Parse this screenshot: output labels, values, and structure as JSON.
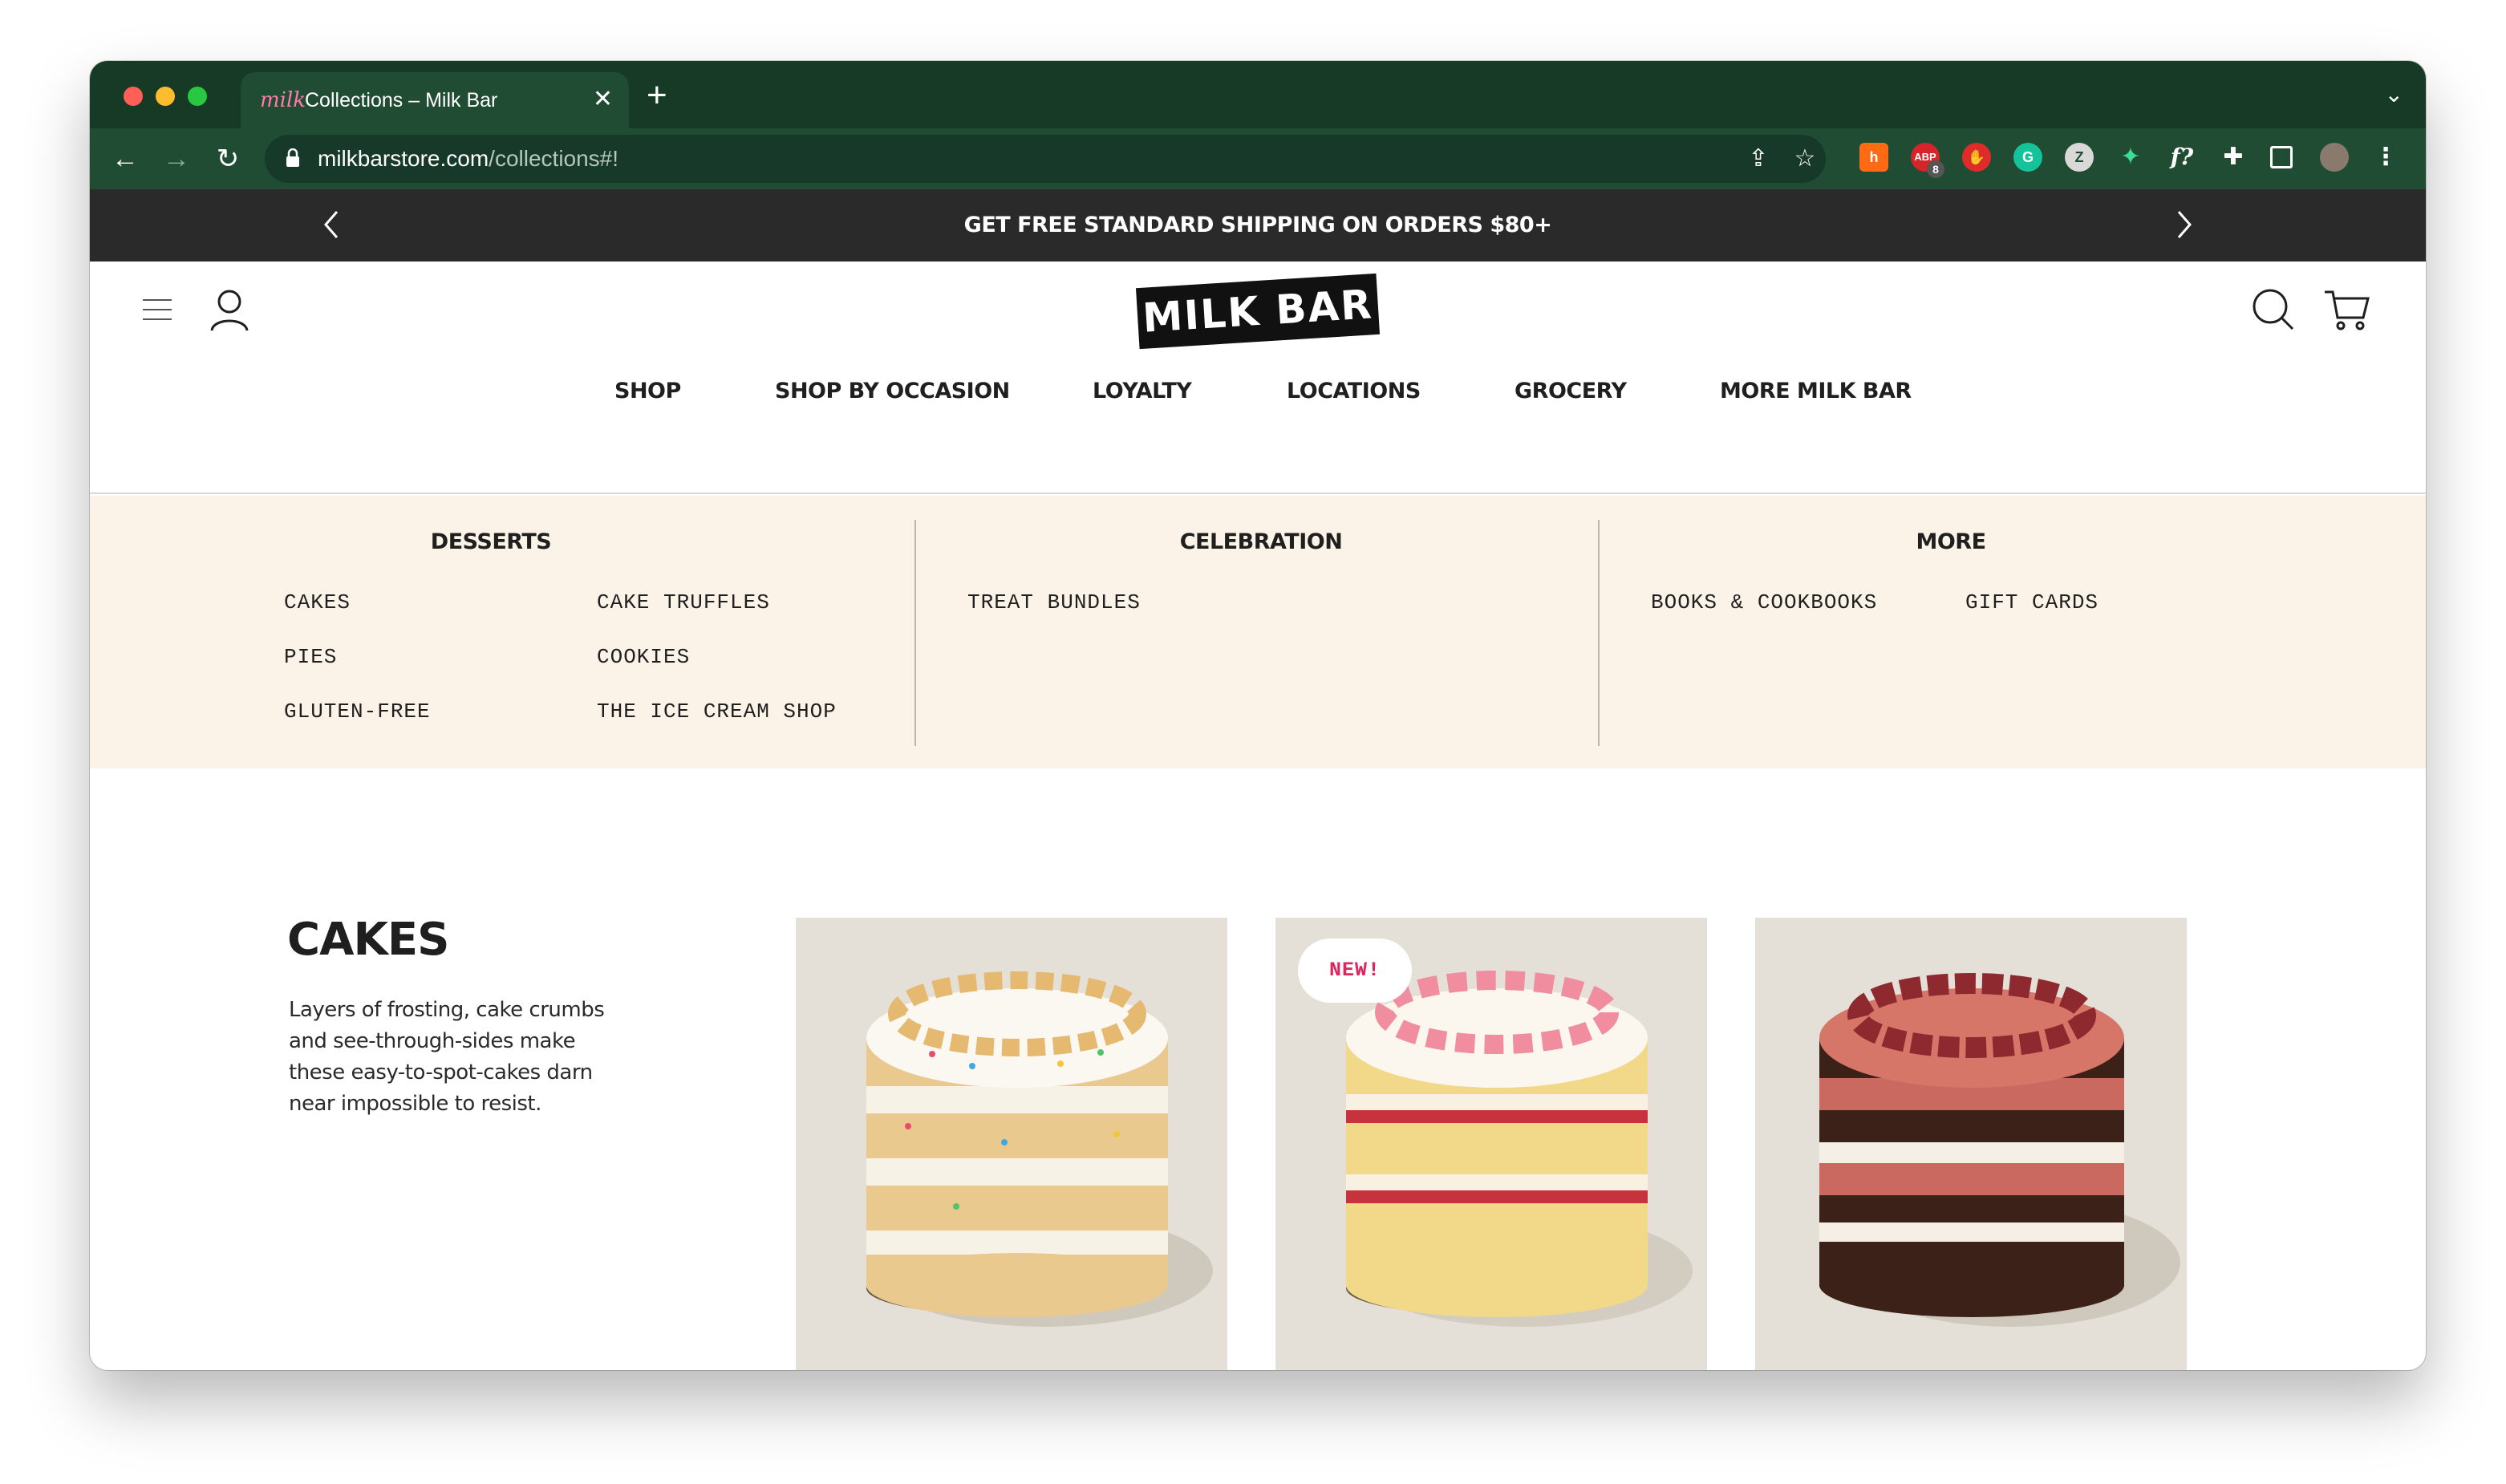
{
  "browser": {
    "tab_title": "Collections – Milk Bar",
    "tab_favicon": "milk",
    "url_host": "milkbarstore.com",
    "url_path": "/collections#!",
    "extensions": [
      "honey",
      "adblock",
      "stop",
      "grammarly",
      "zotero",
      "bird",
      "formula",
      "puzzle"
    ],
    "adblock_count": "8",
    "colors": {
      "tabstrip": "#163a26",
      "toolbar": "#204c33"
    }
  },
  "announcement": {
    "text": "GET FREE STANDARD SHIPPING ON ORDERS $80+"
  },
  "header": {
    "logo": "MILK BAR",
    "nav": [
      {
        "label": "SHOP"
      },
      {
        "label": "SHOP BY OCCASION"
      },
      {
        "label": "LOYALTY"
      },
      {
        "label": "LOCATIONS"
      },
      {
        "label": "GROCERY"
      },
      {
        "label": "MORE MILK BAR"
      }
    ]
  },
  "mega_menu": {
    "columns": [
      {
        "heading": "DESSERTS",
        "links": [
          "CAKES",
          "PIES",
          "GLUTEN-FREE",
          "CAKE TRUFFLES",
          "COOKIES",
          "THE ICE CREAM SHOP"
        ]
      },
      {
        "heading": "CELEBRATION",
        "links": [
          "TREAT BUNDLES"
        ]
      },
      {
        "heading": "MORE",
        "links": [
          "BOOKS & COOKBOOKS",
          "GIFT CARDS"
        ]
      }
    ],
    "background": "#fcf3e8"
  },
  "section": {
    "title": "CAKES",
    "description": "Layers of frosting, cake crumbs and see-through-sides make these easy-to-spot-cakes darn near impossible to resist."
  },
  "products": [
    {
      "image": "birthday-layer-cake",
      "badge": ""
    },
    {
      "image": "strawberry-layer-cake",
      "badge": "NEW!"
    },
    {
      "image": "chocolate-raspberry-layer-cake",
      "badge": ""
    }
  ]
}
